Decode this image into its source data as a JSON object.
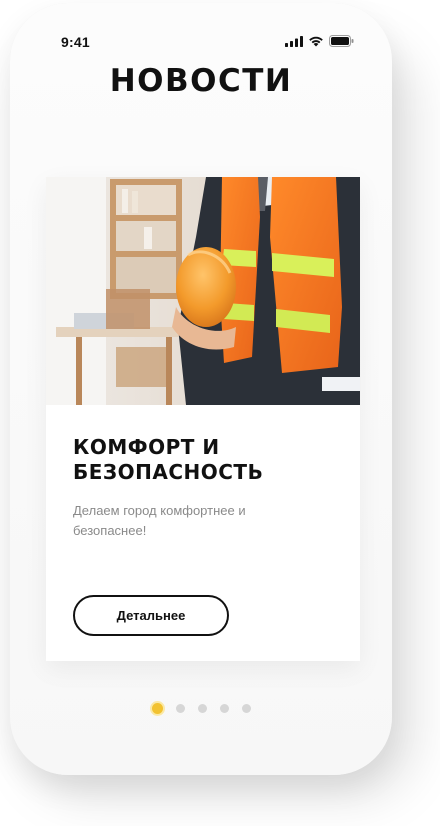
{
  "status_bar": {
    "time": "9:41",
    "icons": [
      "signal-icon",
      "wifi-icon",
      "battery-icon"
    ]
  },
  "page": {
    "title": "НОВОСТИ"
  },
  "card": {
    "image": "worker-in-safety-vest-photo",
    "title": "КОМФОРТ И\nБЕЗОПАСНОСТЬ",
    "description": "Делаем город комфортнее и безопаснее!",
    "button_label": "Детальнее"
  },
  "pagination": {
    "total": 5,
    "active_index": 0
  },
  "colors": {
    "accent_yellow": "#f2c230",
    "text_dark": "#111111",
    "text_muted": "#8a8a8a",
    "vest_orange": "#f47a1f",
    "reflective_stripe": "#d9f05a"
  }
}
